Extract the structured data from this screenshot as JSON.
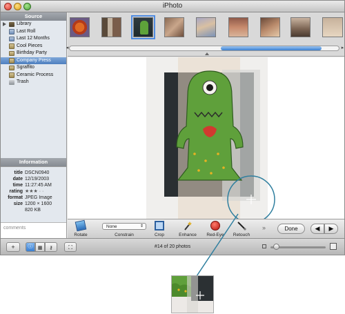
{
  "window": {
    "title": "iPhoto"
  },
  "source": {
    "header": "Source",
    "items": [
      {
        "label": "Library",
        "icon": "library-icon"
      },
      {
        "label": "Last Roll",
        "icon": "roll-icon"
      },
      {
        "label": "Last 12 Months",
        "icon": "calendar-icon"
      },
      {
        "label": "Cool Pieces",
        "icon": "album-icon"
      },
      {
        "label": "Birthday Party",
        "icon": "album-icon"
      },
      {
        "label": "Company Press",
        "icon": "album-icon",
        "selected": true
      },
      {
        "label": "Sgraffito",
        "icon": "album-icon"
      },
      {
        "label": "Ceramic Process",
        "icon": "album-icon"
      },
      {
        "label": "Trash",
        "icon": "trash-icon"
      }
    ]
  },
  "information": {
    "header": "Information",
    "rows": [
      {
        "key": "title",
        "value": "DSCN0940"
      },
      {
        "key": "date",
        "value": "12/19/2003"
      },
      {
        "key": "time",
        "value": "11:27:45 AM"
      },
      {
        "key": "rating",
        "value": "★★★ · ·"
      },
      {
        "key": "format",
        "value": "JPEG Image"
      },
      {
        "key": "size",
        "value": "1200 × 1600"
      },
      {
        "key": "",
        "value": "820 KB"
      }
    ],
    "comments_placeholder": "comments"
  },
  "toolbar": {
    "rotate_label": "Rotate",
    "constrain_value": "None",
    "constrain_label": "Constrain",
    "crop_label": "Crop",
    "enhance_label": "Enhance",
    "redeye_label": "Red-Eye",
    "retouch_label": "Retouch",
    "overflow_label": "»",
    "done_label": "Done",
    "prev_label": "◀",
    "next_label": "▶"
  },
  "bottombar": {
    "add_label": "+",
    "photo_count": "#14 of 20 photos",
    "zoom_level": 0.05
  },
  "colors": {
    "selection": "#4e7fbf",
    "scroll_thumb": "#3a7fd1",
    "callout": "#2f7f9f",
    "redeye": "#d4201c"
  }
}
